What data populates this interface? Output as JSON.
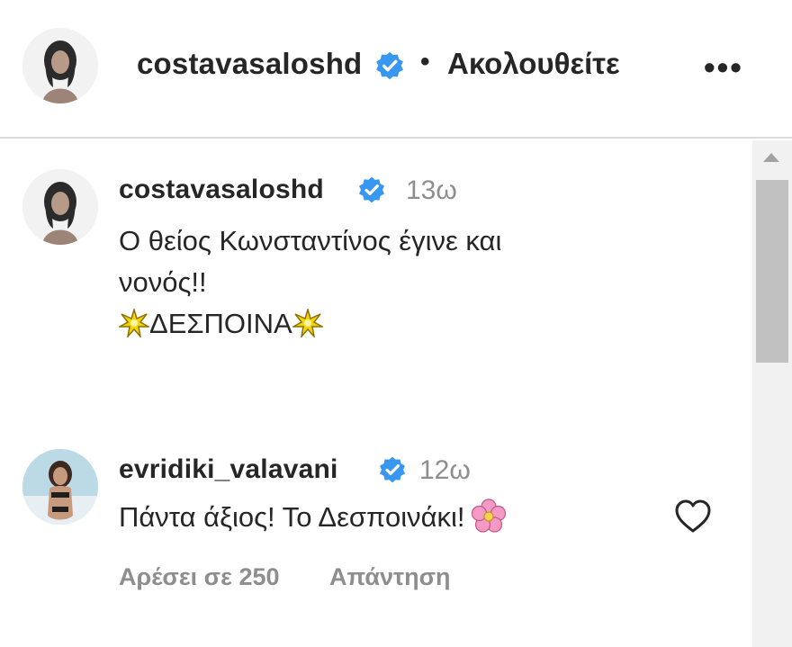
{
  "header": {
    "username": "costavasaloshd",
    "separator": "•",
    "follow_label": "Ακολουθείτε",
    "more_label": "•••",
    "icons": {
      "verified": "verified-badge-icon",
      "more": "more-options-icon"
    }
  },
  "comments": [
    {
      "username": "costavasaloshd",
      "time": "13ω",
      "text_lines": [
        "Ο θείος Κωνσταντίνος έγινε και",
        "νονός!!"
      ],
      "name_text": "ΔΕΣΠΟΙΝΑ",
      "emoji": "sparkle-icon"
    },
    {
      "username": "evridiki_valavani",
      "time": "12ω",
      "text": "Πάντα άξιος! Το Δεσποινάκι!",
      "emoji": "blossom-icon",
      "likes_label": "Αρέσει σε 250",
      "reply_label": "Απάντηση"
    }
  ],
  "colors": {
    "verified_blue": "#3897f0",
    "secondary_text": "#8e8e8e",
    "primary_text": "#262626",
    "divider": "#dbdbdb"
  }
}
